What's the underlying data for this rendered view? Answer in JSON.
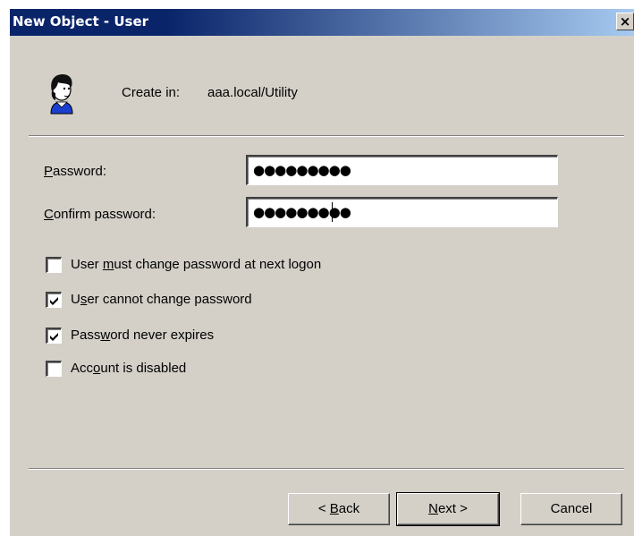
{
  "window": {
    "title": "New Object - User",
    "close_glyph": "×"
  },
  "header": {
    "icon": "user-icon",
    "create_in_label": "Create in:",
    "create_in_path": "aaa.local/Utility"
  },
  "form": {
    "password": {
      "label_first": "P",
      "label_rest": "assword:",
      "masked_value": "●●●●●●●●●"
    },
    "confirm_password": {
      "label_first": "C",
      "label_rest": "onfirm password:",
      "masked_value": "●●●●●●●●●"
    }
  },
  "options": [
    {
      "pre": "User ",
      "ul": "m",
      "post": "ust change password at next logon",
      "checked": false
    },
    {
      "pre": "U",
      "ul": "s",
      "post": "er cannot change password",
      "checked": true
    },
    {
      "pre": "Pass",
      "ul": "w",
      "post": "ord never expires",
      "checked": true
    },
    {
      "pre": "Acc",
      "ul": "o",
      "post": "unt is disabled",
      "checked": false
    }
  ],
  "buttons": {
    "back": {
      "pre": "< ",
      "ul": "B",
      "post": "ack"
    },
    "next": {
      "pre": "",
      "ul": "N",
      "post": "ext >"
    },
    "cancel": "Cancel"
  },
  "colors": {
    "titlebar_start": "#0a246a",
    "titlebar_end": "#a6caf0",
    "dialog_face": "#d4d0c8"
  }
}
